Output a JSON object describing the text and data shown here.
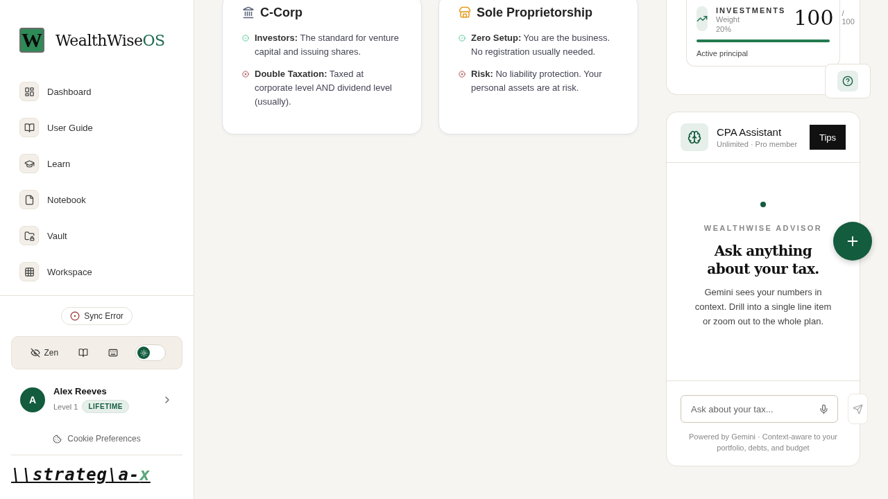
{
  "sidebar": {
    "logo_letter": "W",
    "brand": "WealthWise",
    "brand_suffix": "OS",
    "nav": [
      {
        "label": "Dashboard"
      },
      {
        "label": "User Guide"
      },
      {
        "label": "Learn"
      },
      {
        "label": "Notebook"
      },
      {
        "label": "Vault"
      },
      {
        "label": "Workspace"
      }
    ],
    "sync_status": "Sync Error",
    "toolbar": {
      "zen_label": "Zen",
      "dark_mode": false
    },
    "user": {
      "initial": "A",
      "name": "Alex Reeves",
      "level": "Level 1",
      "badge": "LIFETIME"
    },
    "cookie_link": "Cookie Preferences",
    "footer_logo": {
      "main": "\\\\strateg\\a-",
      "accent": "x"
    }
  },
  "entity_cards": [
    {
      "title": "C-Corp",
      "points": [
        {
          "kind": "pro",
          "text": "**Investors:** The standard for venture capital and issuing shares."
        },
        {
          "kind": "con",
          "text": "**Double Taxation:** Taxed at corporate level AND dividend level (usually)."
        }
      ]
    },
    {
      "title": "Sole Proprietorship",
      "points": [
        {
          "kind": "pro",
          "text": "**Zero Setup:** You are the business. No registration usually needed."
        },
        {
          "kind": "con",
          "text": "**Risk:** No liability protection. Your personal assets are at risk."
        }
      ]
    }
  ],
  "score_card": {
    "category": "INVESTMENTS",
    "weight": "Weight 20%",
    "score": "100",
    "max": "/ 100",
    "level": 1,
    "caption": "Active principal"
  },
  "assistant": {
    "title": "CPA Assistant",
    "subtitle": "Unlimited · Pro member",
    "tips_button": "Tips",
    "eyebrow": "WEALTHWISE ADVISOR",
    "heading": "Ask anything about your tax.",
    "body": "Gemini sees your numbers in context. Drill into a single line item or zoom out to the whole plan.",
    "input_placeholder": "Ask about your tax...",
    "footer": "Powered by Gemini · Context-aware to your portfolio, debts, and budget"
  }
}
